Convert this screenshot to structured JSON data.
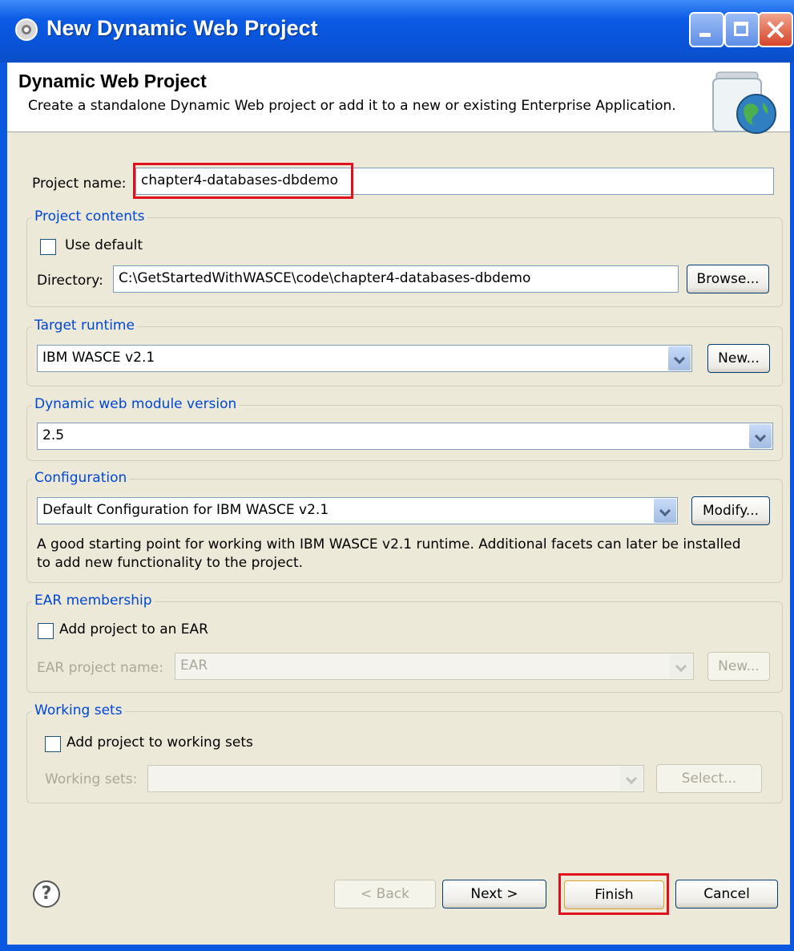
{
  "window": {
    "title": "New Dynamic Web Project"
  },
  "header": {
    "title": "Dynamic Web Project",
    "description": "Create a standalone Dynamic Web project or add it to a new or existing Enterprise Application."
  },
  "project_name": {
    "label": "Project name:",
    "value": "chapter4-databases-dbdemo"
  },
  "project_contents": {
    "title": "Project contents",
    "use_default_label": "Use default",
    "use_default_checked": false,
    "directory_label": "Directory:",
    "directory_value": "C:\\GetStartedWithWASCE\\code\\chapter4-databases-dbdemo",
    "browse_label": "Browse..."
  },
  "target_runtime": {
    "title": "Target runtime",
    "value": "IBM WASCE v2.1",
    "new_label": "New..."
  },
  "module_version": {
    "title": "Dynamic web module version",
    "value": "2.5"
  },
  "configuration": {
    "title": "Configuration",
    "value": "Default Configuration for IBM WASCE v2.1",
    "modify_label": "Modify...",
    "desc_line1": "A good starting point for working with IBM WASCE v2.1 runtime. Additional facets can later be installed",
    "desc_line2": "to add new functionality to the project."
  },
  "ear_membership": {
    "title": "EAR membership",
    "add_label": "Add project to an EAR",
    "add_checked": false,
    "name_label": "EAR project name:",
    "name_value": "EAR",
    "new_label": "New..."
  },
  "working_sets": {
    "title": "Working sets",
    "add_label": "Add project to working sets",
    "add_checked": false,
    "sets_label": "Working sets:",
    "sets_value": "",
    "select_label": "Select..."
  },
  "footer": {
    "help_icon": "?",
    "back_label": "< Back",
    "next_label": "Next >",
    "finish_label": "Finish",
    "cancel_label": "Cancel"
  },
  "colors": {
    "highlight": "#e0101e",
    "group_title": "#0046d5",
    "titlebar": "#0853d8"
  }
}
